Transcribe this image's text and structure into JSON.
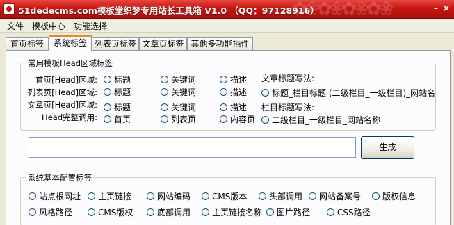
{
  "window": {
    "title": "51dedecms.com模板堂织梦专用站长工具箱 V1.0 （QQ：97128916）"
  },
  "menu": [
    "文件",
    "模板中心",
    "功能选择"
  ],
  "tabs": [
    "首页标签",
    "系统标签",
    "列表页标签",
    "文章页标签",
    "其他多功能插件"
  ],
  "active_tab": "系统标签",
  "head_group": {
    "title": "常用模板Head区域标签",
    "rows": [
      {
        "label": "首页[Head]区域:",
        "options": [
          "标题",
          "关键词",
          "描述"
        ]
      },
      {
        "label": "列表页[Head]区域:",
        "options": [
          "标题",
          "关键词",
          "描述"
        ]
      },
      {
        "label": "文章页[Head]区域:",
        "options": [
          "标题",
          "关键词",
          "描述"
        ]
      },
      {
        "label": "Head完整调用:",
        "options": [
          "首页",
          "列表页",
          "内容页"
        ]
      }
    ],
    "article_title_label": "文章标题写法:",
    "article_title_option": "标题_栏目标题 (二级栏目_一级栏目)_网站名",
    "column_title_label": "栏目标题写法:",
    "column_title_option": "二级栏目_一级栏目_网站名称"
  },
  "output": {
    "value": "",
    "generate_label": "生成"
  },
  "sys_group": {
    "title": "系统基本配置标签",
    "row1": [
      "站点根网址",
      "主页链接",
      "网站编码",
      "CMS版本",
      "头部调用",
      "网站备案号",
      "版权信息"
    ],
    "row2": [
      "风格路径",
      "CMS版权",
      "底部调用",
      "主页链接名称",
      "图片路径",
      "CSS路径"
    ]
  }
}
